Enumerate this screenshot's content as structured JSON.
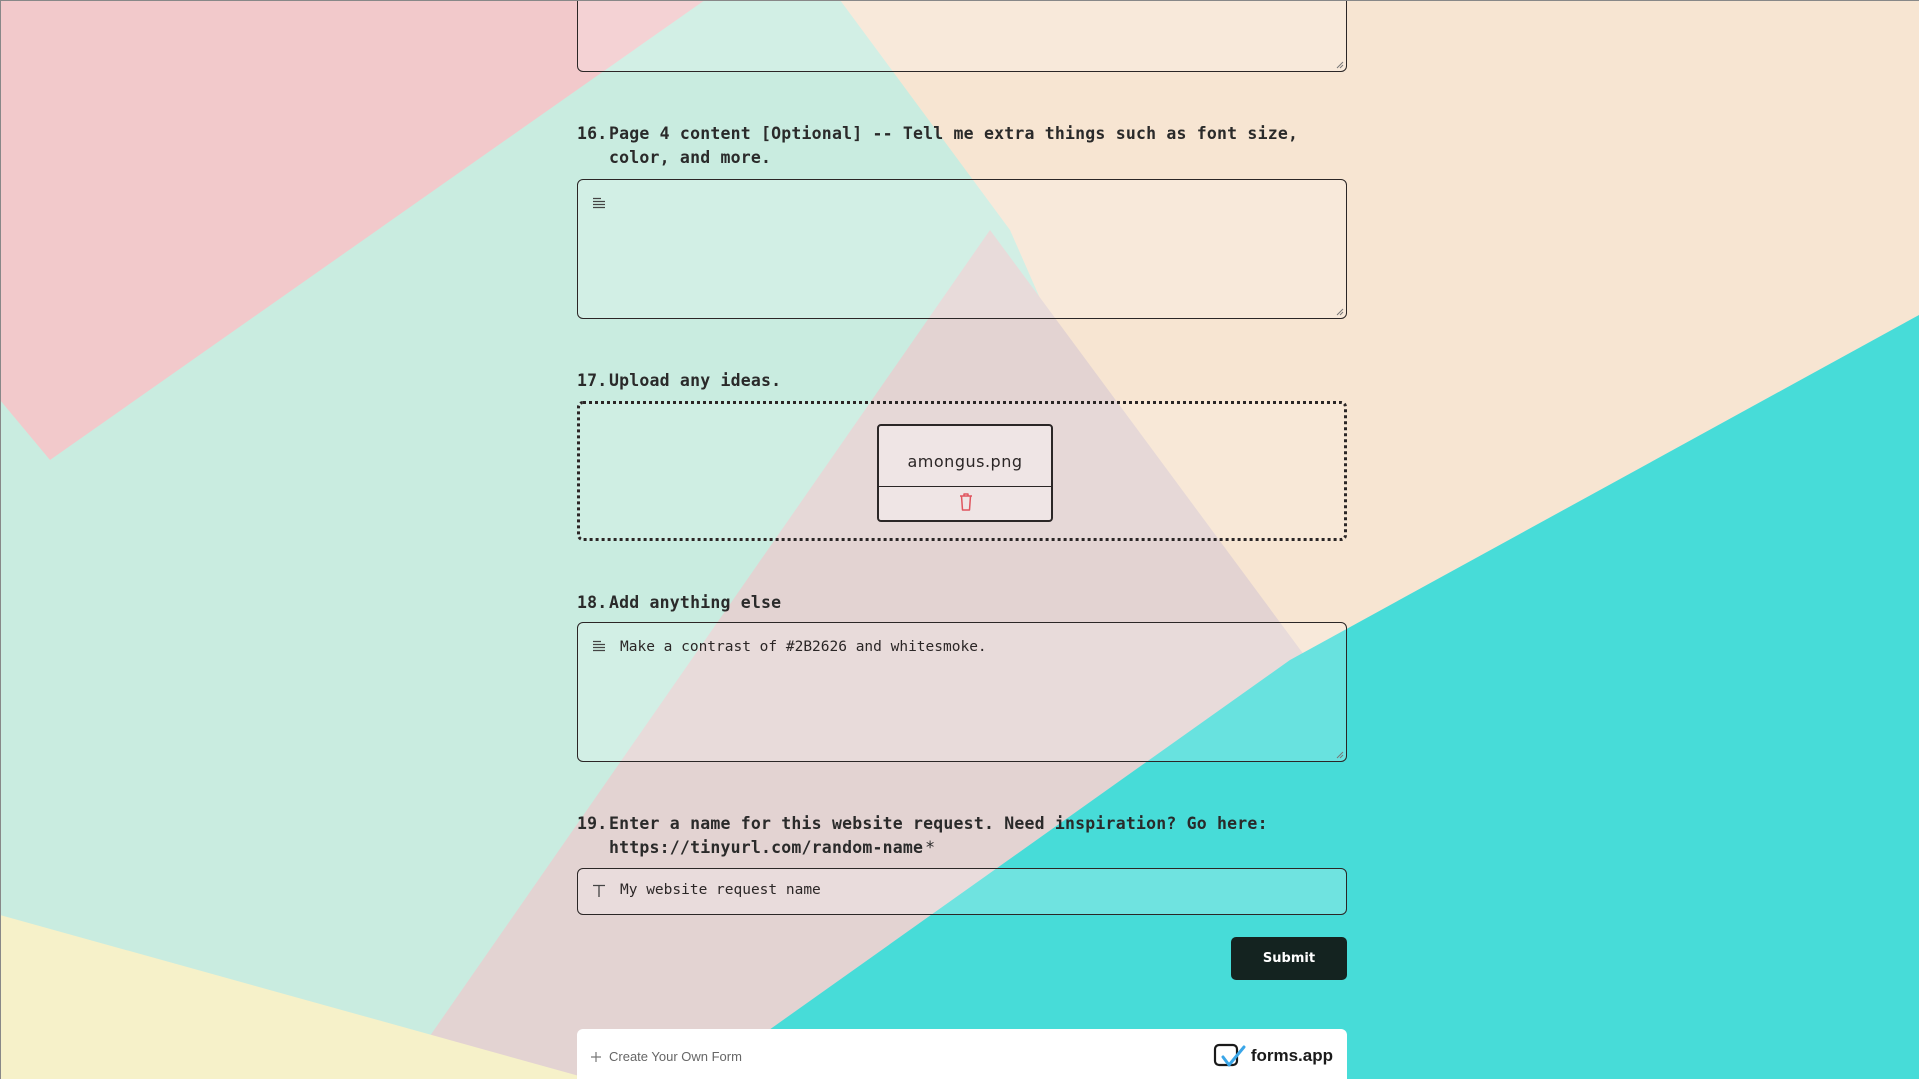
{
  "questions": [
    {
      "number": "16.",
      "text": "Page 4 content [Optional] -- Tell me extra things such as font size, color, and more.",
      "value": ""
    },
    {
      "number": "17.",
      "text": "Upload any ideas.",
      "file_name": "amongus.png"
    },
    {
      "number": "18.",
      "text": "Add anything else",
      "value": "Make a contrast of #2B2626 and whitesmoke."
    },
    {
      "number": "19.",
      "text": "Enter a name for this website request. Need inspiration? Go here: https://tinyurl.com/random-name",
      "required_mark": "*",
      "value": "My website request name"
    }
  ],
  "submit_label": "Submit",
  "footer": {
    "create_label": "Create Your Own Form",
    "brand": "forms.app"
  },
  "icons": {
    "textarea": "lines-icon",
    "delete": "trash-icon",
    "text_input": "text-icon",
    "create": "plus-icon",
    "brand": "forms-app-logo"
  },
  "colors": {
    "text": "#2B2626",
    "submit_bg": "#142320",
    "delete_icon": "#E0555E"
  }
}
